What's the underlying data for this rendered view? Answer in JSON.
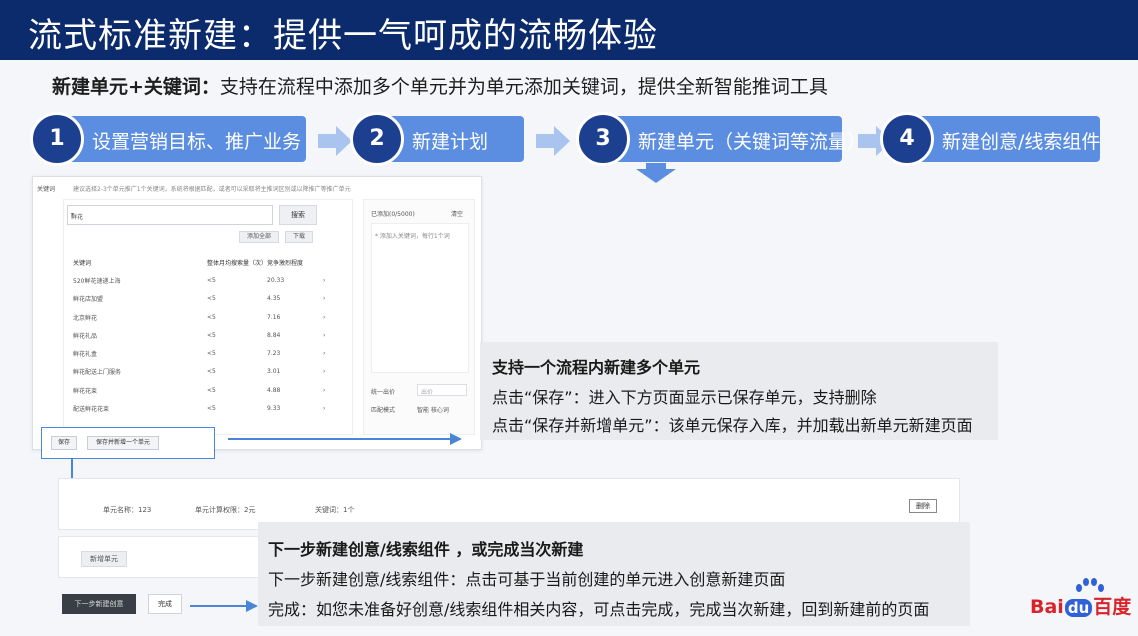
{
  "header": {
    "title": "流式标准新建：提供一气呵成的流畅体验"
  },
  "subtitle": {
    "bold": "新建单元+关键词：",
    "text": "支持在流程中添加多个单元并为单元添加关键词，提供全新智能推词工具"
  },
  "steps": [
    {
      "num": "1",
      "label": "设置营销目标、推广业务"
    },
    {
      "num": "2",
      "label": "新建计划"
    },
    {
      "num": "3",
      "label": "新建单元（关键词等流量）"
    },
    {
      "num": "4",
      "label": "新建创意/线索组件"
    }
  ],
  "keyword_panel": {
    "section_label": "关键词",
    "description": "建议选择2-3个单元推广1个关键词，系统将根据匹配，或者可以采取将主推词区别或以降推广等推广单元",
    "search_value": "鲜花",
    "search_button": "搜索",
    "add_all_button": "添加全部",
    "download_button": "下载",
    "columns": [
      "关键词",
      "整体月均搜索量（次）",
      "竞争激烈程度"
    ],
    "rows": [
      [
        "520鲜花速递上海",
        "<5",
        "20.33"
      ],
      [
        "鲜花店加盟",
        "<5",
        "4.35"
      ],
      [
        "北京鲜花",
        "<5",
        "7.16"
      ],
      [
        "鲜花礼品",
        "<5",
        "8.84"
      ],
      [
        "鲜花礼盒",
        "<5",
        "7.23"
      ],
      [
        "鲜花配送上门服务",
        "<5",
        "3.01"
      ],
      [
        "鲜花花束",
        "<5",
        "4.88"
      ],
      [
        "配送鲜花花束",
        "<5",
        "9.33"
      ]
    ],
    "added_label": "已添加(0/5000)",
    "clear_label": "清空",
    "empty_hint": "* 添加入关键词，每行1个词",
    "unify_label": "统一出价",
    "unify_placeholder": "出价",
    "match_label": "匹配模式",
    "match_value": "智能 核心词",
    "save_button": "保存",
    "save_new_button": "保存并新增一个单元"
  },
  "callout1": {
    "heading": "支持一个流程内新建多个单元",
    "line1": "点击“保存”：进入下方页面显示已保存单元，支持删除",
    "line2": "点击“保存并新增单元”：该单元保存入库，并加载出新单元新建页面"
  },
  "unit_summary": {
    "name_label": "单元名称：123",
    "budget_label": "单元计算权限：2元",
    "keyword_count": "关键词：1个",
    "delete_button": "删除",
    "new_unit_button": "新增单元",
    "next_button": "下一步新建创意",
    "done_button": "完成"
  },
  "callout2": {
    "heading": "下一步新建创意/线索组件 ，或完成当次新建",
    "line1": "下一步新建创意/线索组件：点击可基于当前创建的单元进入创意新建页面",
    "line2": "完成：如您未准备好创意/线索组件相关内容，可点击完成，完成当次新建，回到新建前的页面"
  },
  "logo": {
    "bai": "Bai",
    "du": "du",
    "cn": "百度"
  },
  "colors": {
    "header_bg": "#0b2b6d",
    "step_bg": "#5b8de0",
    "step_circle": "#1d3f8f",
    "accent_line": "#4a86d8",
    "logo_red": "#d8232a",
    "logo_blue": "#2f61d8"
  }
}
